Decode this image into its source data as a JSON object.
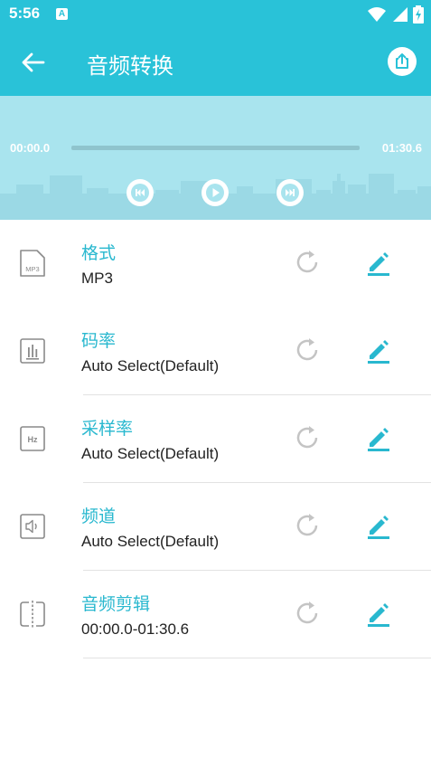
{
  "status_bar": {
    "time": "5:56",
    "notification_badge": "A",
    "icons": [
      "wifi-icon",
      "signal-icon",
      "battery-charging-icon"
    ]
  },
  "app_bar": {
    "title": "音频转换",
    "back_icon": "arrow-left-icon",
    "share_icon": "share-icon"
  },
  "player": {
    "current_time": "00:00.0",
    "total_time": "01:30.6",
    "progress": 0,
    "controls": [
      "skip-previous-icon",
      "play-icon",
      "skip-next-icon"
    ]
  },
  "settings": [
    {
      "title": "格式",
      "value": "MP3",
      "icon": "mp3-file-icon",
      "icon_text": "MP3"
    },
    {
      "title": "码率",
      "value": "Auto Select(Default)",
      "icon": "bitrate-chart-icon"
    },
    {
      "title": "采样率",
      "value": "Auto Select(Default)",
      "icon": "hz-icon",
      "icon_text": "Hz"
    },
    {
      "title": "频道",
      "value": "Auto Select(Default)",
      "icon": "speaker-icon"
    },
    {
      "title": "音频剪辑",
      "value": "00:00.0-01:30.6",
      "icon": "trim-icon"
    }
  ],
  "colors": {
    "accent": "#29c2d8",
    "player_bg": "#a9e4ee",
    "title_text": "#29b8cf",
    "reset_icon": "#c4c4c4"
  }
}
